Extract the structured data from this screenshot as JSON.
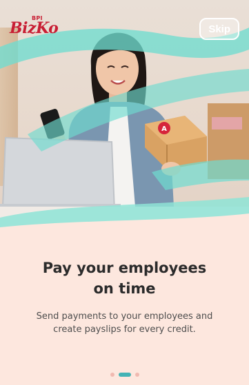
{
  "logo": {
    "brand_small": "BPI",
    "brand_word": "BizKo"
  },
  "skip_label": "Skip",
  "onboarding": {
    "title": "Pay your employees\non time",
    "subtitle": "Send payments to your employees and create payslips for every credit."
  },
  "pager": {
    "total": 3,
    "active_index": 1
  },
  "colors": {
    "background": "#fde7de",
    "accent_teal": "#43b3b5",
    "ribbon_mint": "#7fe0d3",
    "brand_red": "#c81e34",
    "inactive_dot": "#f0b9b0"
  }
}
